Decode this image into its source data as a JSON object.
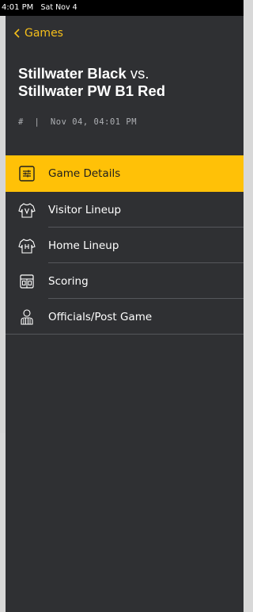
{
  "status": {
    "time": "4:01 PM",
    "date": "Sat Nov 4"
  },
  "nav": {
    "back_label": "Games"
  },
  "game": {
    "home_team": "Stillwater Black",
    "vs": "vs.",
    "away_team": "Stillwater PW B1 Red",
    "meta": "#  |  Nov 04, 04:01 PM"
  },
  "menu": {
    "items": [
      {
        "label": "Game Details",
        "icon": "sliders-icon",
        "active": true
      },
      {
        "label": "Visitor Lineup",
        "icon": "jersey-v-icon",
        "active": false
      },
      {
        "label": "Home Lineup",
        "icon": "jersey-h-icon",
        "active": false
      },
      {
        "label": "Scoring",
        "icon": "scoreboard-icon",
        "active": false
      },
      {
        "label": "Officials/Post Game",
        "icon": "referee-icon",
        "active": false
      }
    ]
  },
  "colors": {
    "accent": "#ffc107",
    "link": "#f6bf1b",
    "panel": "#2f3033",
    "status_bar": "#000000"
  }
}
